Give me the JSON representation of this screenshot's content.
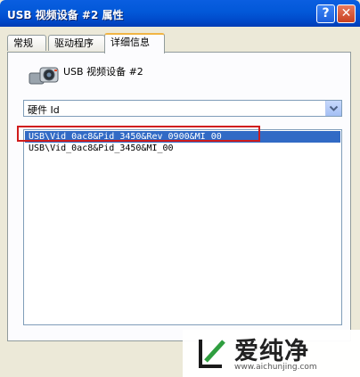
{
  "window": {
    "title": "USB 视频设备 #2 属性",
    "help_label": "?",
    "close_label": "✕"
  },
  "tabs": [
    {
      "label": "常规",
      "active": false
    },
    {
      "label": "驱动程序",
      "active": false
    },
    {
      "label": "详细信息",
      "active": true
    }
  ],
  "device": {
    "name": "USB 视频设备 #2",
    "icon": "camera-icon"
  },
  "property_select": {
    "selected": "硬件 Id",
    "arrow_icon": "chevron-down-icon"
  },
  "values_list": {
    "items": [
      {
        "text": "USB\\Vid_0ac8&Pid_3450&Rev_0900&MI_00",
        "selected": true
      },
      {
        "text": "USB\\Vid_0ac8&Pid_3450&MI_00",
        "selected": false
      }
    ]
  },
  "watermark": {
    "brand": "爱纯净",
    "url": "www.aichunjing.com"
  },
  "colors": {
    "titlebar": "#0058e6",
    "selection": "#316ac5",
    "highlight_box": "#d01c1c",
    "active_tab_accent": "#f1b544"
  }
}
